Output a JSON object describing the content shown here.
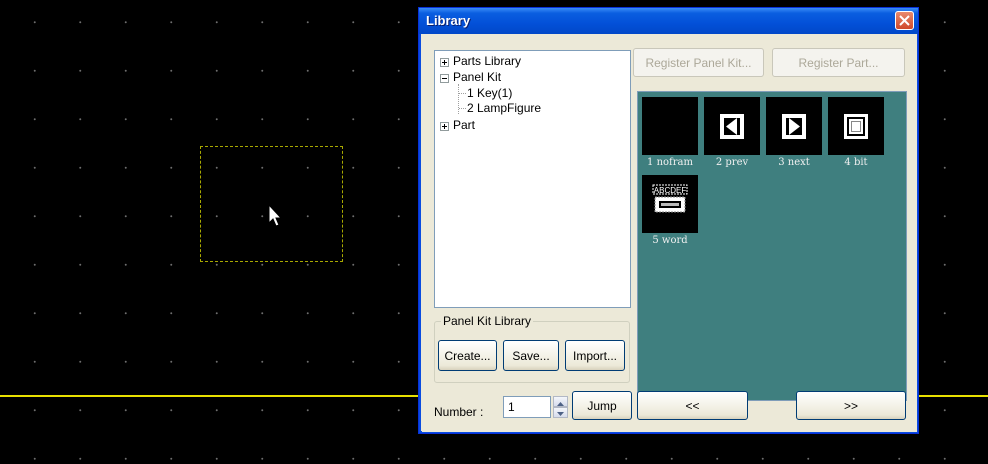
{
  "dialog": {
    "title": "Library",
    "close_icon": "close-icon"
  },
  "tree": {
    "items": [
      {
        "label": "Parts Library",
        "state": "collapsed"
      },
      {
        "label": "Panel Kit",
        "state": "expanded"
      },
      {
        "label": "1 Key(1)"
      },
      {
        "label": "2 LampFigure"
      },
      {
        "label": "Part",
        "state": "collapsed"
      }
    ]
  },
  "toolbar": {
    "register_panel_kit": "Register Panel Kit...",
    "register_part": "Register Part..."
  },
  "parts": [
    {
      "label": "1 nofram",
      "icon": "blank-frame-icon"
    },
    {
      "label": "2 prev",
      "icon": "prev-arrow-icon"
    },
    {
      "label": "3 next",
      "icon": "next-arrow-icon"
    },
    {
      "label": "4 bit",
      "icon": "bit-square-icon"
    },
    {
      "label": "5 word",
      "icon": "word-display-icon",
      "thumb_text": "ABCDEF"
    }
  ],
  "panel_kit_library": {
    "legend": "Panel Kit Library",
    "create": "Create...",
    "save": "Save...",
    "import": "Import..."
  },
  "footer": {
    "number_label": "Number :",
    "number_value": "1",
    "jump": "Jump",
    "prev": "<<",
    "next": ">>"
  },
  "colors": {
    "canvas_bg": "#000000",
    "grid_dot": "#6e6e6e",
    "guide_line": "#e8e000",
    "selection_border": "#a8a800",
    "parts_bg": "#3f7f7f",
    "titlebar": "#0350d8"
  }
}
